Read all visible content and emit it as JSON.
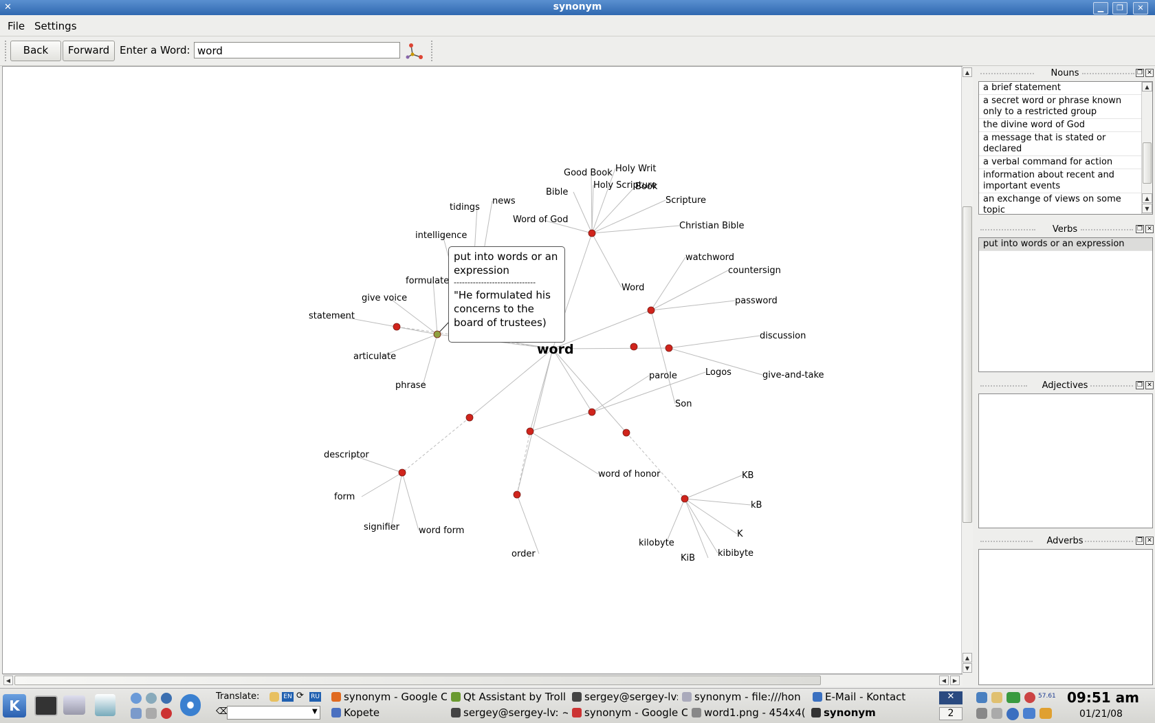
{
  "window": {
    "title": "synonym"
  },
  "menu": {
    "file": "File",
    "settings": "Settings"
  },
  "toolbar": {
    "back": "Back",
    "forward": "Forward",
    "enter_label": "Enter a Word:",
    "word_value": "word"
  },
  "graph": {
    "center": "word",
    "tooltip": {
      "title": "put into words or an expression",
      "divider": "------------------------------",
      "example": "\"He formulated his concerns to the board of trustees)"
    },
    "labels": [
      "Good Book",
      "Holy Writ",
      "Holy Scripture",
      "Book",
      "Bible",
      "Scripture",
      "Word of God",
      "Christian Bible",
      "news",
      "tidings",
      "intelligence",
      "formulate",
      "give voice",
      "statement",
      "articulate",
      "phrase",
      "Word",
      "watchword",
      "countersign",
      "password",
      "discussion",
      "give-and-take",
      "Logos",
      "parole",
      "Son",
      "word of honor",
      "descriptor",
      "form",
      "signifier",
      "word form",
      "order",
      "KB",
      "kB",
      "K",
      "kibibyte",
      "KiB",
      "kilobyte"
    ]
  },
  "panels": {
    "nouns": {
      "title": "Nouns",
      "items": [
        "a brief statement",
        "a secret word or phrase known only to a restricted group",
        "the divine word of God",
        "a message that is stated or declared",
        "a verbal command for action",
        "information about recent and important events",
        "an exchange of views on some topic"
      ]
    },
    "verbs": {
      "title": "Verbs",
      "items": [
        "put into words or an expression"
      ]
    },
    "adjectives": {
      "title": "Adjectives"
    },
    "adverbs": {
      "title": "Adverbs"
    }
  },
  "taskbar": {
    "translate_label": "Translate:",
    "lang_en": "EN",
    "lang_ru": "RU",
    "tasks_row1": [
      "synonym - Google C",
      "Qt Assistant by Troll",
      "sergey@sergey-lv: ~",
      "synonym - file:///hon",
      "E-Mail - Kontact"
    ],
    "tasks_row2": [
      "Kopete",
      "sergey@sergey-lv: ~",
      "synonym - Google C",
      "word1.png - 454x4(",
      "synonym"
    ],
    "desktop": "2",
    "tray_num": "57.61",
    "clock_time": "09:51 am",
    "clock_date": "01/21/08"
  },
  "colors": {
    "node": "#d0241c",
    "selected_node": "#8fa040",
    "title_bar": "#3a74bc"
  }
}
